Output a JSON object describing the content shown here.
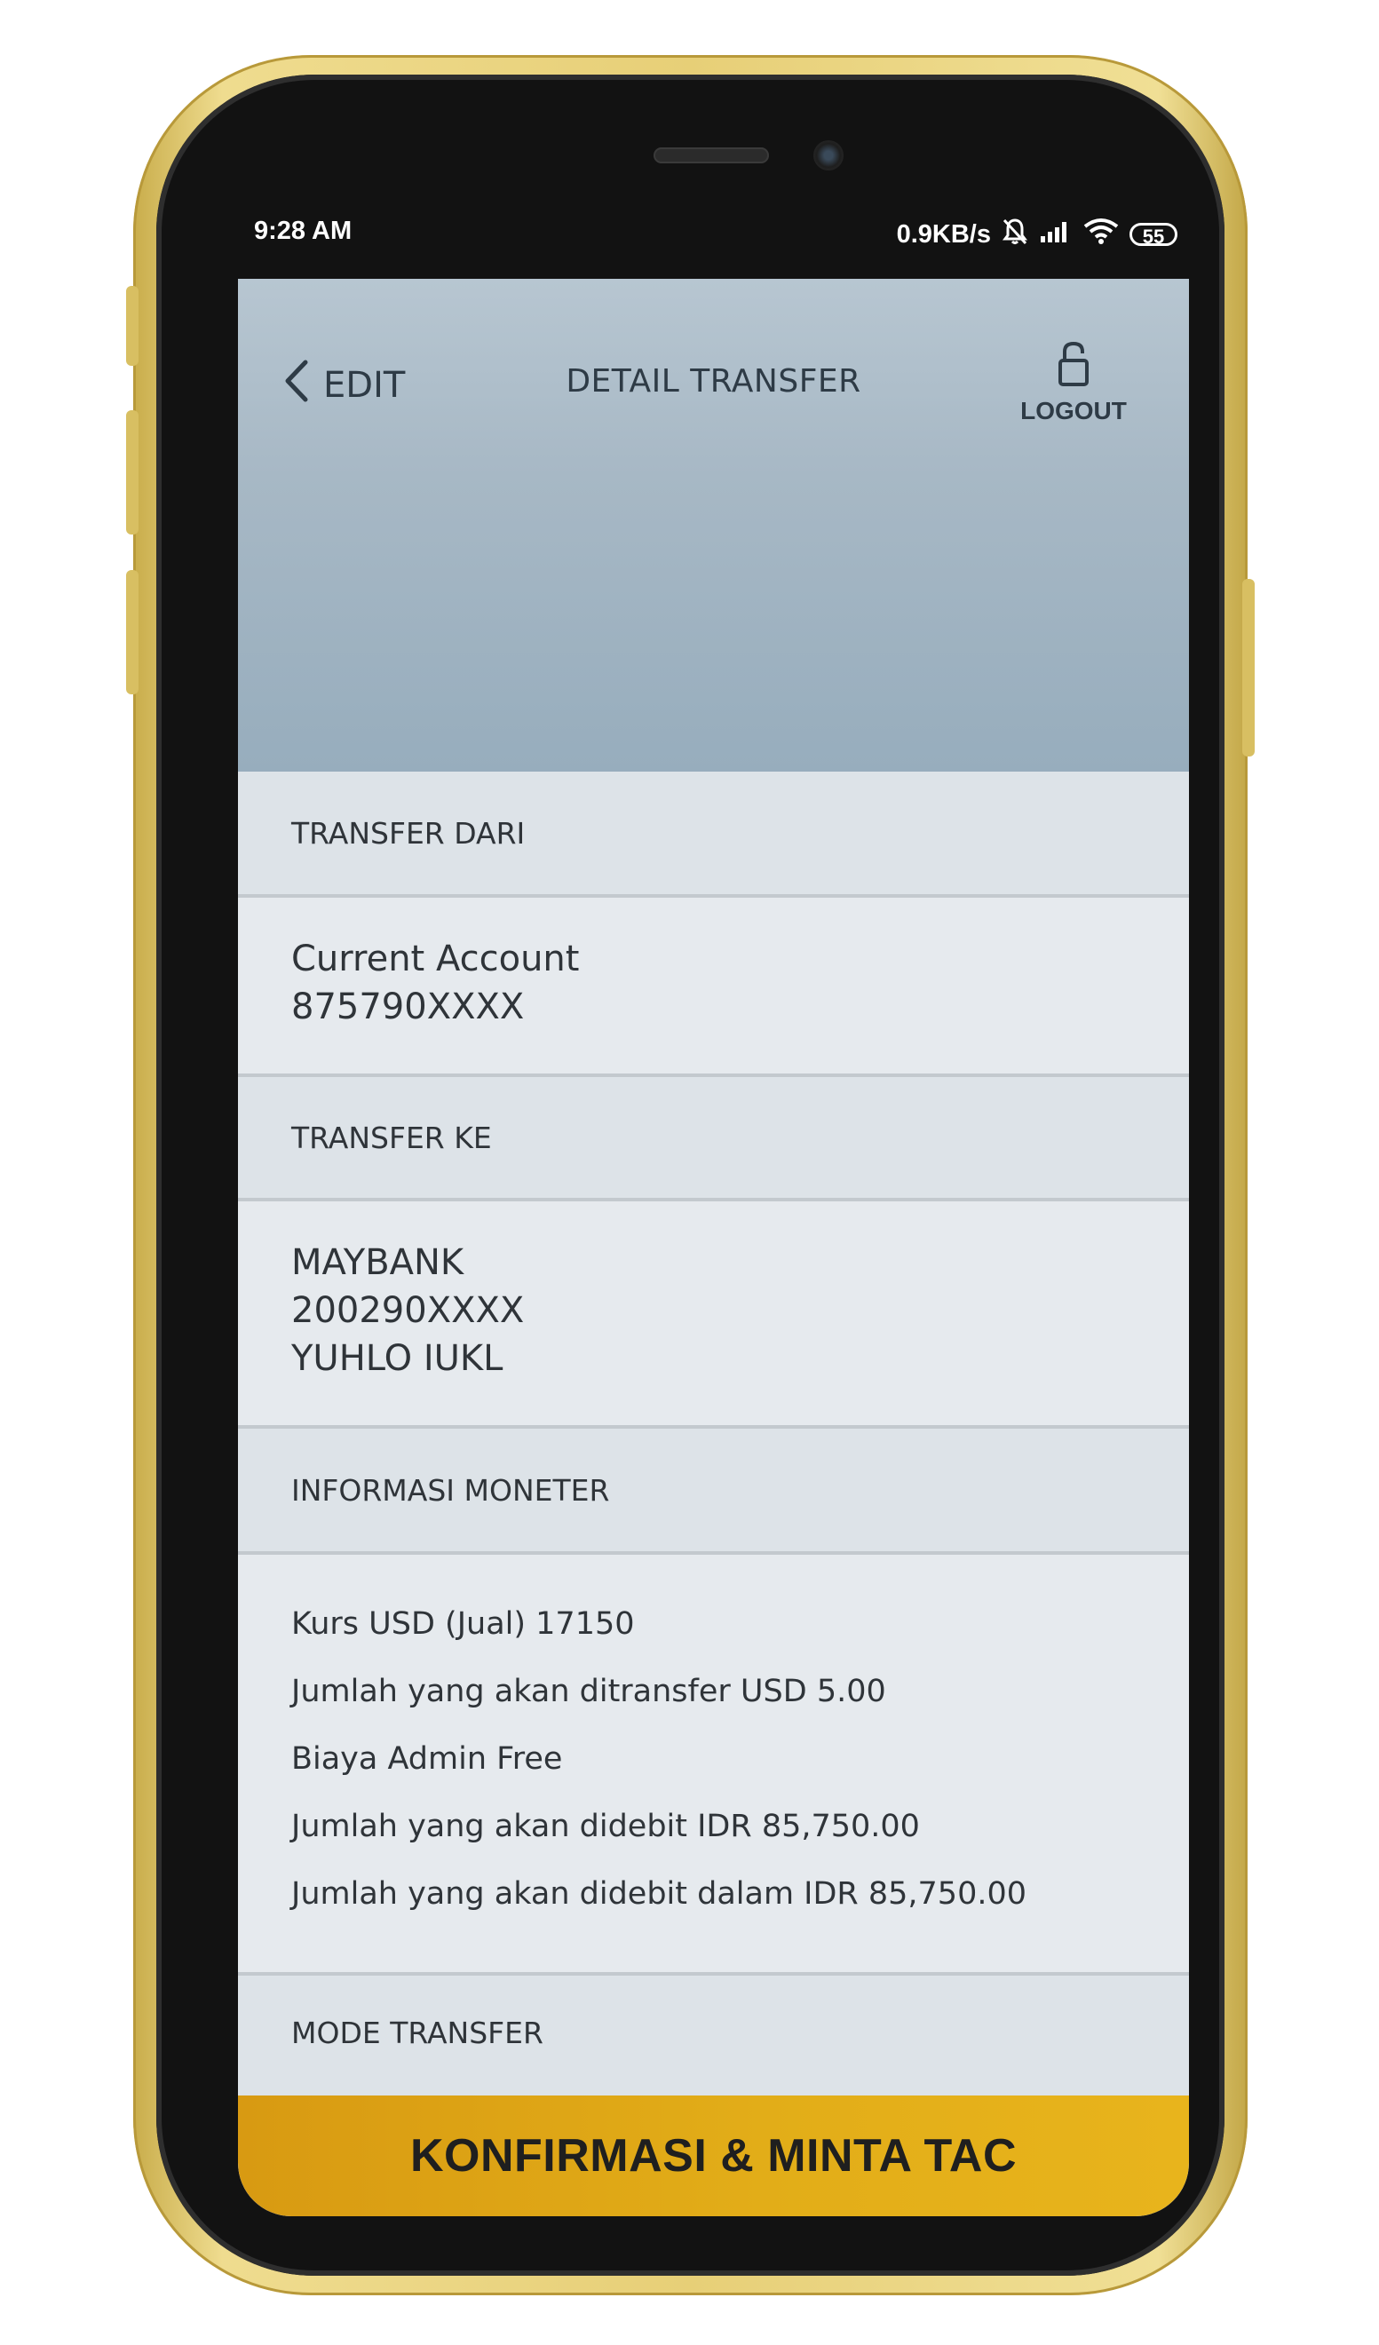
{
  "status_bar": {
    "time": "9:28 AM",
    "net_speed": "0.9KB/s",
    "battery": "55"
  },
  "header": {
    "back_label": "EDIT",
    "title": "DETAIL TRANSFER",
    "logout_label": "LOGOUT"
  },
  "transfer_from": {
    "heading": "TRANSFER DARI",
    "account_type": "Current Account",
    "account_number": "875790XXXX"
  },
  "transfer_to": {
    "heading": "TRANSFER KE",
    "bank": "MAYBANK",
    "account_number": "200290XXXX",
    "name": "YUHLO IUKL"
  },
  "monetary_info": {
    "heading": "INFORMASI MONETER",
    "lines": [
      "Kurs USD (Jual) 17150",
      "Jumlah yang akan ditransfer USD 5.00",
      "Biaya Admin Free",
      "Jumlah yang akan didebit IDR 85,750.00",
      "Jumlah yang akan didebit dalam IDR 85,750.00"
    ]
  },
  "transfer_mode": {
    "heading": "MODE TRANSFER"
  },
  "cta": {
    "label": "KONFIRMASI & MINTA TAC"
  },
  "colors": {
    "phone_frame": "#e7cf77",
    "header_bg": "#a7b8c5",
    "cta_bg": "#e2ad18",
    "text": "#2f3439"
  },
  "icons": {
    "back": "chevron-left-icon",
    "logout": "unlocked-padlock-icon",
    "mute": "bell-off-icon",
    "signal": "signal-bars-icon",
    "wifi": "wifi-icon",
    "battery": "battery-icon"
  }
}
